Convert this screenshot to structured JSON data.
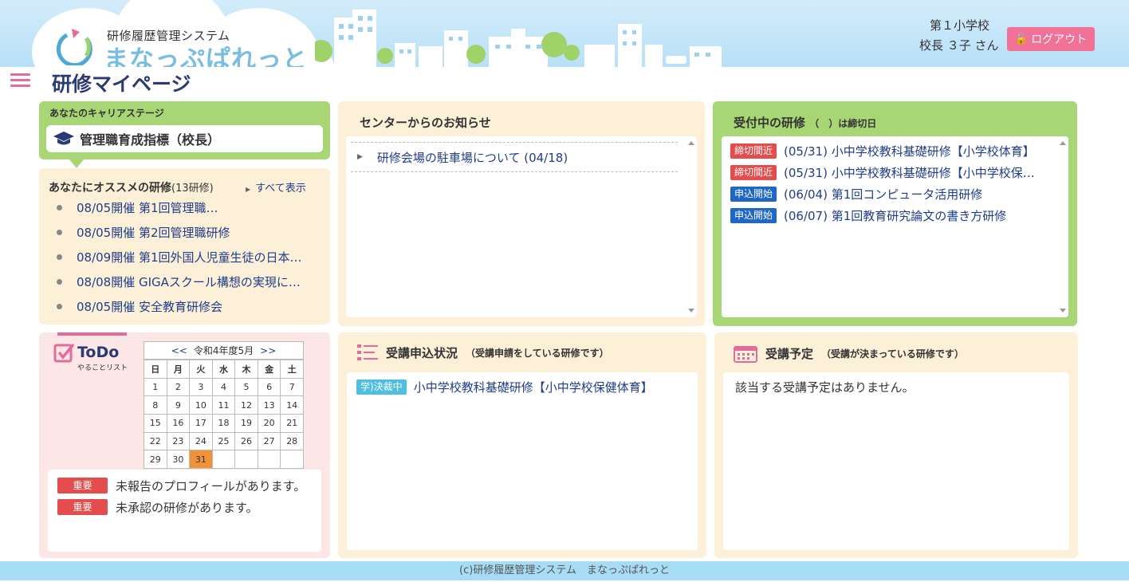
{
  "header": {
    "logo_subtitle": "研修履歴管理システム",
    "logo_title": "まなっぷぱれっと",
    "school": "第１小学校",
    "user": "校長 ３子 さん",
    "logout": "ログアウト"
  },
  "page_title": "研修マイページ",
  "career": {
    "label": "あなたのキャリアステージ",
    "stage": "管理職育成指標（校長）"
  },
  "recommend": {
    "title": "あなたにオススメの研修",
    "count": "(13研修)",
    "show_all": "すべて表示",
    "items": [
      "08/05開催 第1回管理職…",
      "08/05開催 第2回管理職研修",
      "08/09開催 第1回外国人児童生徒の日本…",
      "08/08開催 GIGAスクール構想の実現に…",
      "08/05開催 安全教育研修会"
    ]
  },
  "news": {
    "title": "センターからのお知らせ",
    "items": [
      "研修会場の駐車場について (04/18)"
    ]
  },
  "open_trainings": {
    "title": "受付中の研修",
    "note": "（　）は締切日",
    "items": [
      {
        "badge": "締切間近",
        "text": "(05/31) 小中学校教科基礎研修【小学校体育】"
      },
      {
        "badge": "締切間近",
        "text": "(05/31) 小中学校教科基礎研修【小中学校保…"
      },
      {
        "badge": "申込開始",
        "text": "(06/04) 第1回コンピュータ活用研修"
      },
      {
        "badge": "申込開始",
        "text": "(06/07) 第1回教育研究論文の書き方研修"
      }
    ]
  },
  "todo": {
    "title": "ToDo",
    "subtitle": "やることリスト",
    "calendar": {
      "prev": "<<",
      "month": "令和4年度5月",
      "next": ">>",
      "weekdays": [
        "日",
        "月",
        "火",
        "水",
        "木",
        "金",
        "土"
      ],
      "weeks": [
        [
          "1",
          "2",
          "3",
          "4",
          "5",
          "6",
          "7"
        ],
        [
          "8",
          "9",
          "10",
          "11",
          "12",
          "13",
          "14"
        ],
        [
          "15",
          "16",
          "17",
          "18",
          "19",
          "20",
          "21"
        ],
        [
          "22",
          "23",
          "24",
          "25",
          "26",
          "27",
          "28"
        ],
        [
          "29",
          "30",
          "31",
          "",
          "",
          "",
          ""
        ]
      ],
      "today": "31"
    },
    "items": [
      {
        "badge": "重要",
        "text": "未報告のプロフィールがあります。"
      },
      {
        "badge": "重要",
        "text": "未承認の研修があります。"
      }
    ]
  },
  "apply_status": {
    "title": "受講申込状況",
    "note": "（受講申請をしている研修です）",
    "items": [
      {
        "badge": "学)決裁中",
        "text": "小中学校教科基礎研修【小中学校保健体育】"
      }
    ]
  },
  "schedule": {
    "title": "受講予定",
    "note": "（受講が決まっている研修です）",
    "empty": "該当する受講予定はありません。"
  },
  "footer": "(c)研修履歴管理システム　まなっぷぱれっと",
  "colors": {
    "accent_pink": "#f17296",
    "green": "#a8d675",
    "cream": "#fdf0d8",
    "navy": "#2a3a72",
    "link": "#1f3d8a"
  }
}
